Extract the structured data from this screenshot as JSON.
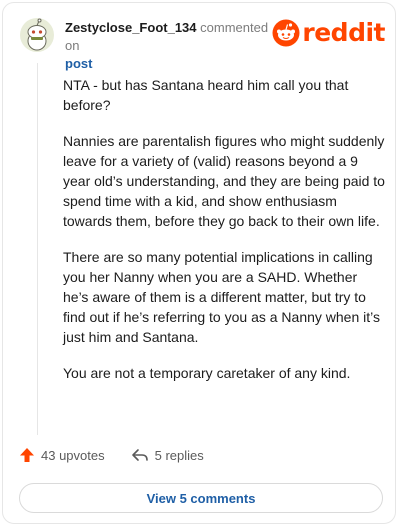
{
  "header": {
    "username": "Zestyclose_Foot_134",
    "commented_on": "commented on",
    "post_link": "post"
  },
  "brand": {
    "wordmark": "reddit",
    "color": "#ff4500",
    "icon": "reddit-snoo-icon"
  },
  "comment": {
    "paragraphs": [
      "NTA - but has Santana heard him call you that before?",
      "Nannies are parentalish figures who might suddenly leave for a variety of (valid) reasons beyond a 9 year old’s understanding, and they are being paid to spend time with a kid, and show enthusiasm towards them, before they go back to their own life.",
      "There are so many potential implications in calling you her Nanny when you are a SAHD. Whether he’s aware of them is a different matter, but try to find out if he’s referring to you as a Nanny when it’s just him and Santana.",
      "You are not a temporary caretaker of any kind."
    ]
  },
  "actions": {
    "upvotes": "43 upvotes",
    "upvote_icon": "upvote-arrow-icon",
    "replies": "5 replies",
    "reply_icon": "reply-arrow-icon"
  },
  "view_comments": "View 5 comments",
  "colors": {
    "link": "#1f5fa6",
    "upvote": "#ff4500",
    "text": "#1c1c1c",
    "muted": "#7c7c7c"
  }
}
